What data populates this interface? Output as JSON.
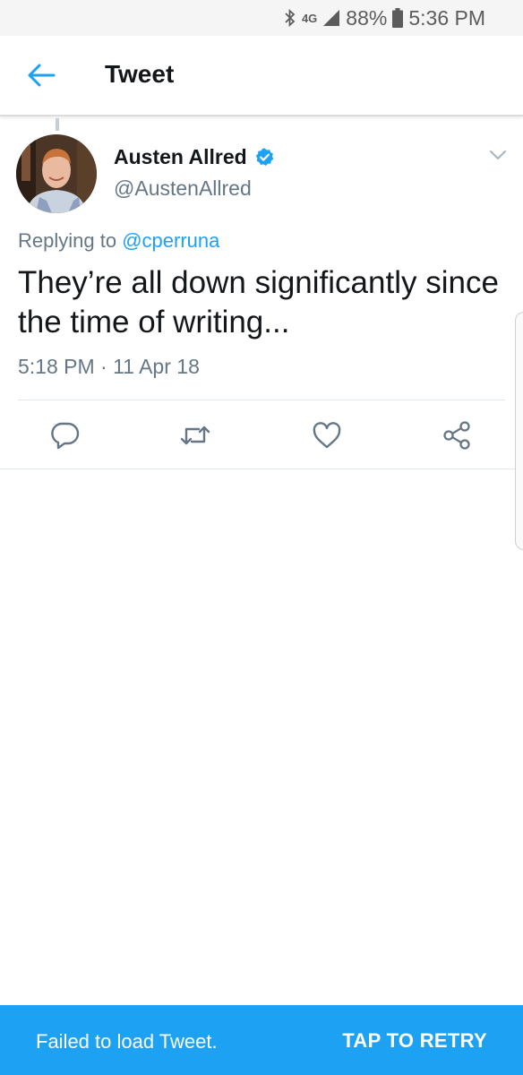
{
  "status_bar": {
    "network": "4G",
    "battery": "88%",
    "time": "5:36 PM"
  },
  "app_bar": {
    "title": "Tweet"
  },
  "tweet": {
    "author_name": "Austen Allred",
    "author_handle": "@AustenAllred",
    "replying_prefix": "Replying to",
    "replying_handle": "@cperruna",
    "text": "They’re all down significantly since the time of writing...",
    "timestamp": "5:18 PM · 11 Apr 18"
  },
  "actions": {
    "reply_icon": "speech-bubble-icon",
    "retweet_icon": "retweet-icon",
    "like_icon": "heart-icon",
    "share_icon": "share-icon"
  },
  "snackbar": {
    "message": "Failed to load Tweet.",
    "action": "TAP TO RETRY"
  },
  "colors": {
    "accent": "#1da1f2",
    "text_primary": "#14171a",
    "text_secondary": "#657786"
  }
}
